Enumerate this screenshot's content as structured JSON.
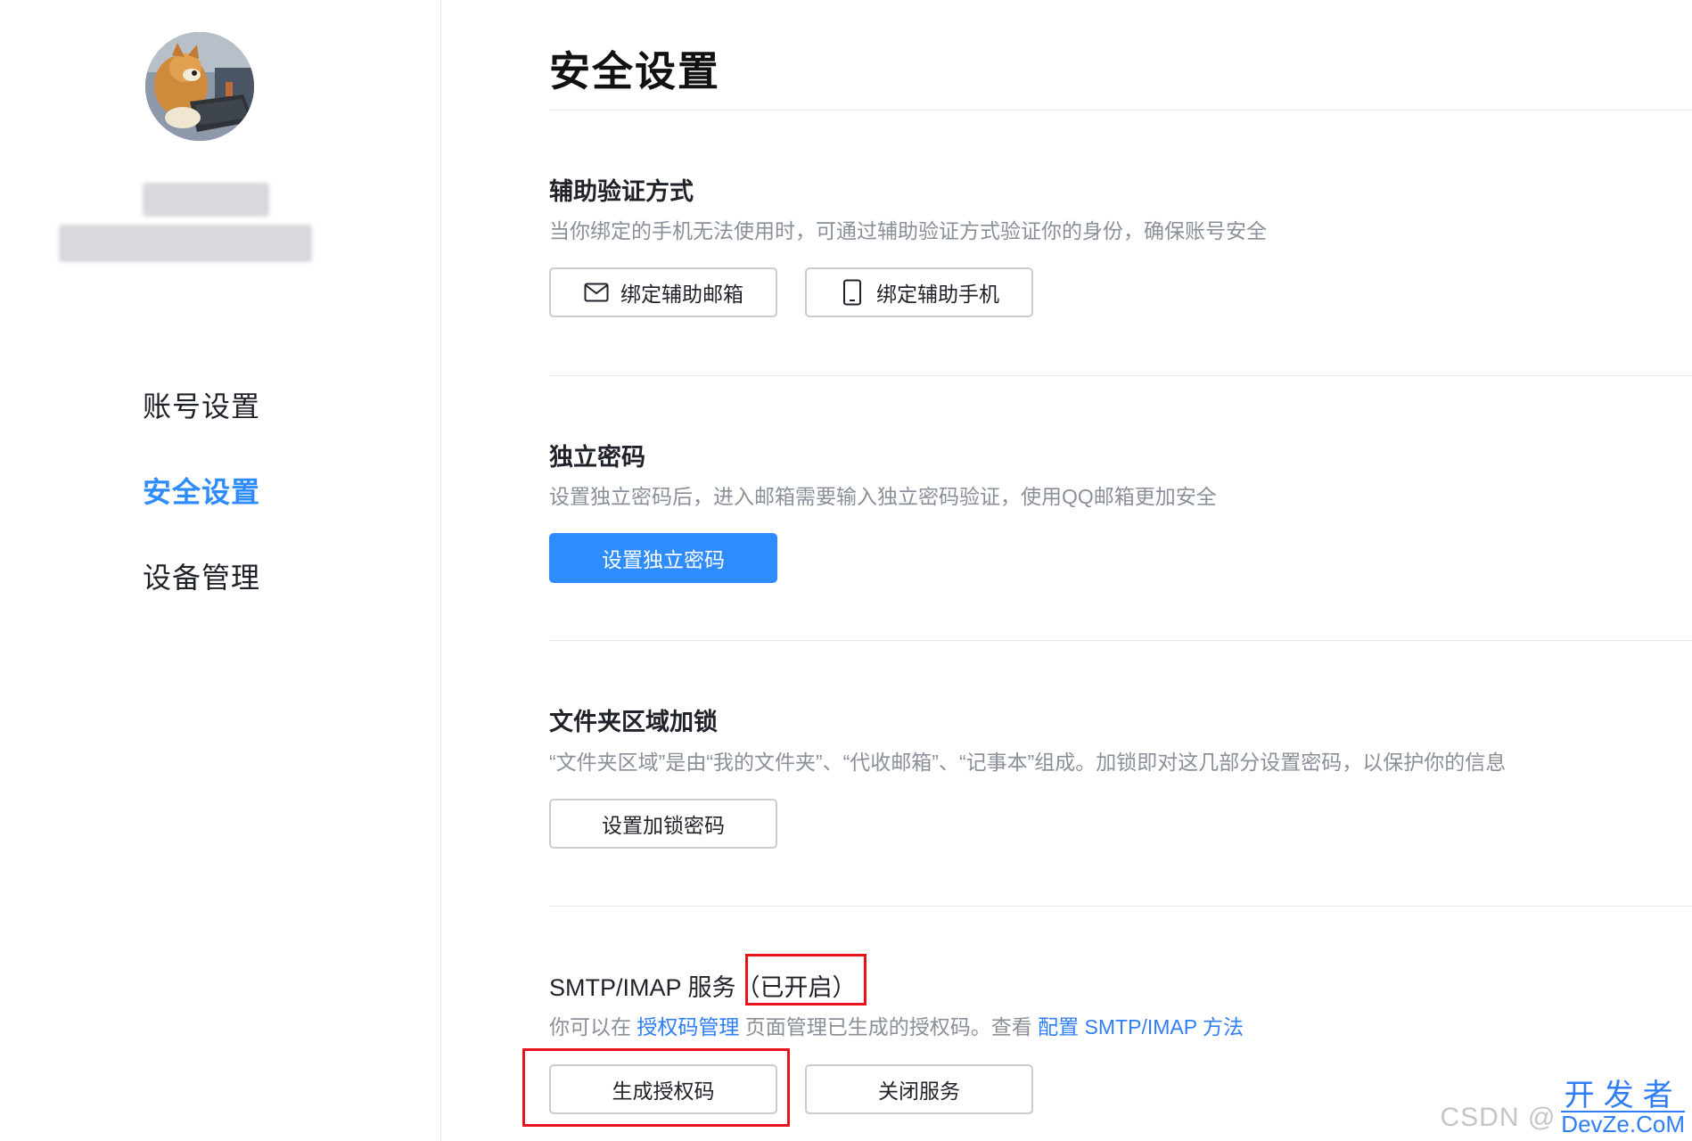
{
  "sidebar": {
    "items": [
      {
        "label": "账号设置",
        "active": false
      },
      {
        "label": "安全设置",
        "active": true
      },
      {
        "label": "设备管理",
        "active": false
      }
    ]
  },
  "main": {
    "title": "安全设置",
    "sections": [
      {
        "title": "辅助验证方式",
        "desc": "当你绑定的手机无法使用时，可通过辅助验证方式验证你的身份，确保账号安全",
        "buttons": [
          {
            "label": "绑定辅助邮箱",
            "icon": "mail-icon"
          },
          {
            "label": "绑定辅助手机",
            "icon": "phone-icon"
          }
        ]
      },
      {
        "title": "独立密码",
        "desc": "设置独立密码后，进入邮箱需要输入独立密码验证，使用QQ邮箱更加安全",
        "buttons": [
          {
            "label": "设置独立密码",
            "style": "primary"
          }
        ]
      },
      {
        "title": "文件夹区域加锁",
        "desc": "“文件夹区域”是由“我的文件夹”、“代收邮箱”、“记事本”组成。加锁即对这几部分设置密码，以保护你的信息",
        "buttons": [
          {
            "label": "设置加锁密码"
          }
        ]
      },
      {
        "title": "SMTP/IMAP 服务",
        "status": "（已开启）",
        "desc_parts": [
          "你可以在 ",
          "授权码管理",
          " 页面管理已生成的授权码。查看 ",
          "配置 SMTP/IMAP 方法"
        ],
        "buttons": [
          {
            "label": "生成授权码"
          },
          {
            "label": "关闭服务"
          }
        ]
      }
    ]
  },
  "watermark": {
    "csdn": "CSDN @",
    "brand_cn": "开发者",
    "brand_en": "DevZe.CoM"
  },
  "colors": {
    "accent": "#2f8cff",
    "link": "#2f7ef5",
    "highlight": "#e8141b",
    "muted": "#8a9099"
  }
}
